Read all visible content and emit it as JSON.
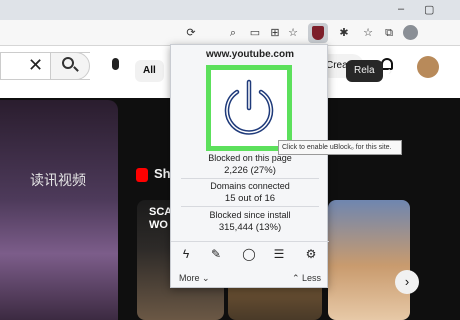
{
  "browser": {
    "window_controls": [
      "–",
      "▢"
    ],
    "toolbar_icons": [
      "refresh-icon",
      "zoom-icon",
      "cast-icon",
      "favorite-icon",
      "ublock-icon",
      "extensions-icon",
      "favorites-bar-icon",
      "collections-icon",
      "profile-icon"
    ]
  },
  "youtube": {
    "create_label": "Create",
    "chip_all": "All",
    "chip_related": "Rela",
    "chip_next": "›",
    "channel_text": "读讯视频",
    "shorts_label": "Sh",
    "short1_text": "SCA\nWO",
    "next_arrow": "›"
  },
  "popup": {
    "domain": "www.youtube.com",
    "blocked_on_page_label": "Blocked on this page",
    "blocked_on_page_value": "2,226 (27%)",
    "domains_connected_label": "Domains connected",
    "domains_connected_value": "15 out of 16",
    "blocked_since_install_label": "Blocked since install",
    "blocked_since_install_value": "315,444 (13%)",
    "tools": [
      "lightning-icon",
      "eyedropper-icon",
      "chat-icon",
      "list-icon",
      "settings-icon"
    ],
    "more_label": "More",
    "less_label": "Less"
  },
  "tooltip": {
    "text": "Click to enable uBlock₀ for this site."
  },
  "colors": {
    "power_border": "#5ce05c",
    "power_icon": "#1f3a7a",
    "ublock_red": "#7d1f2a"
  }
}
